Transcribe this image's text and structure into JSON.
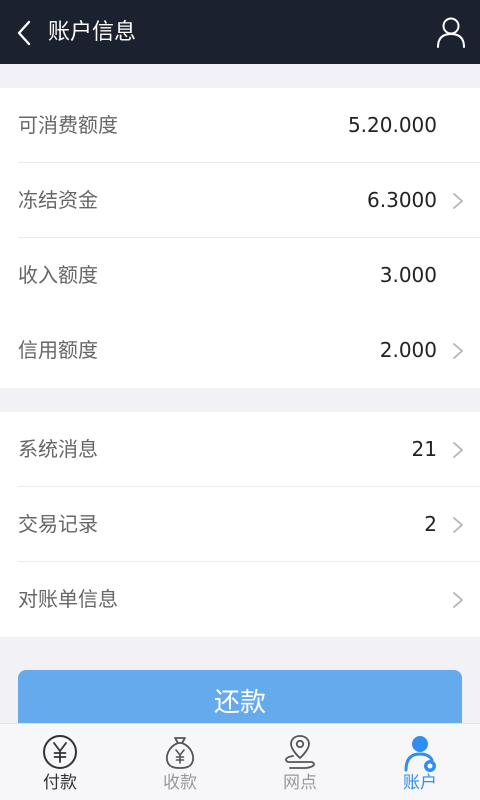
{
  "header": {
    "title": "账户信息"
  },
  "balance_section": {
    "rows": [
      {
        "label": "可消费额度",
        "value": "5.20.000",
        "has_arrow": false
      },
      {
        "label": "冻结资金",
        "value": "6.3000",
        "has_arrow": true
      },
      {
        "label": "收入额度",
        "value": "3.000",
        "has_arrow": false
      },
      {
        "label": "信用额度",
        "value": "2.000",
        "has_arrow": true
      }
    ]
  },
  "records_section": {
    "rows": [
      {
        "label": "系统消息",
        "value": "21",
        "has_arrow": true
      },
      {
        "label": "交易记录",
        "value": "2",
        "has_arrow": true
      },
      {
        "label": "对账单信息",
        "value": "",
        "has_arrow": true
      }
    ]
  },
  "repay_button": {
    "label": "还款"
  },
  "tabbar": {
    "tabs": [
      {
        "label": "付款",
        "icon": "yuan-coin-icon"
      },
      {
        "label": "收款",
        "icon": "money-bag-icon"
      },
      {
        "label": "网点",
        "icon": "location-pin-icon"
      },
      {
        "label": "账户",
        "icon": "account-user-icon",
        "active": true
      }
    ]
  },
  "colors": {
    "header_bg": "#1c2130",
    "page_bg": "#f2f2f6",
    "button_bg": "#66aaee",
    "active_tab": "#2f8ef0"
  }
}
